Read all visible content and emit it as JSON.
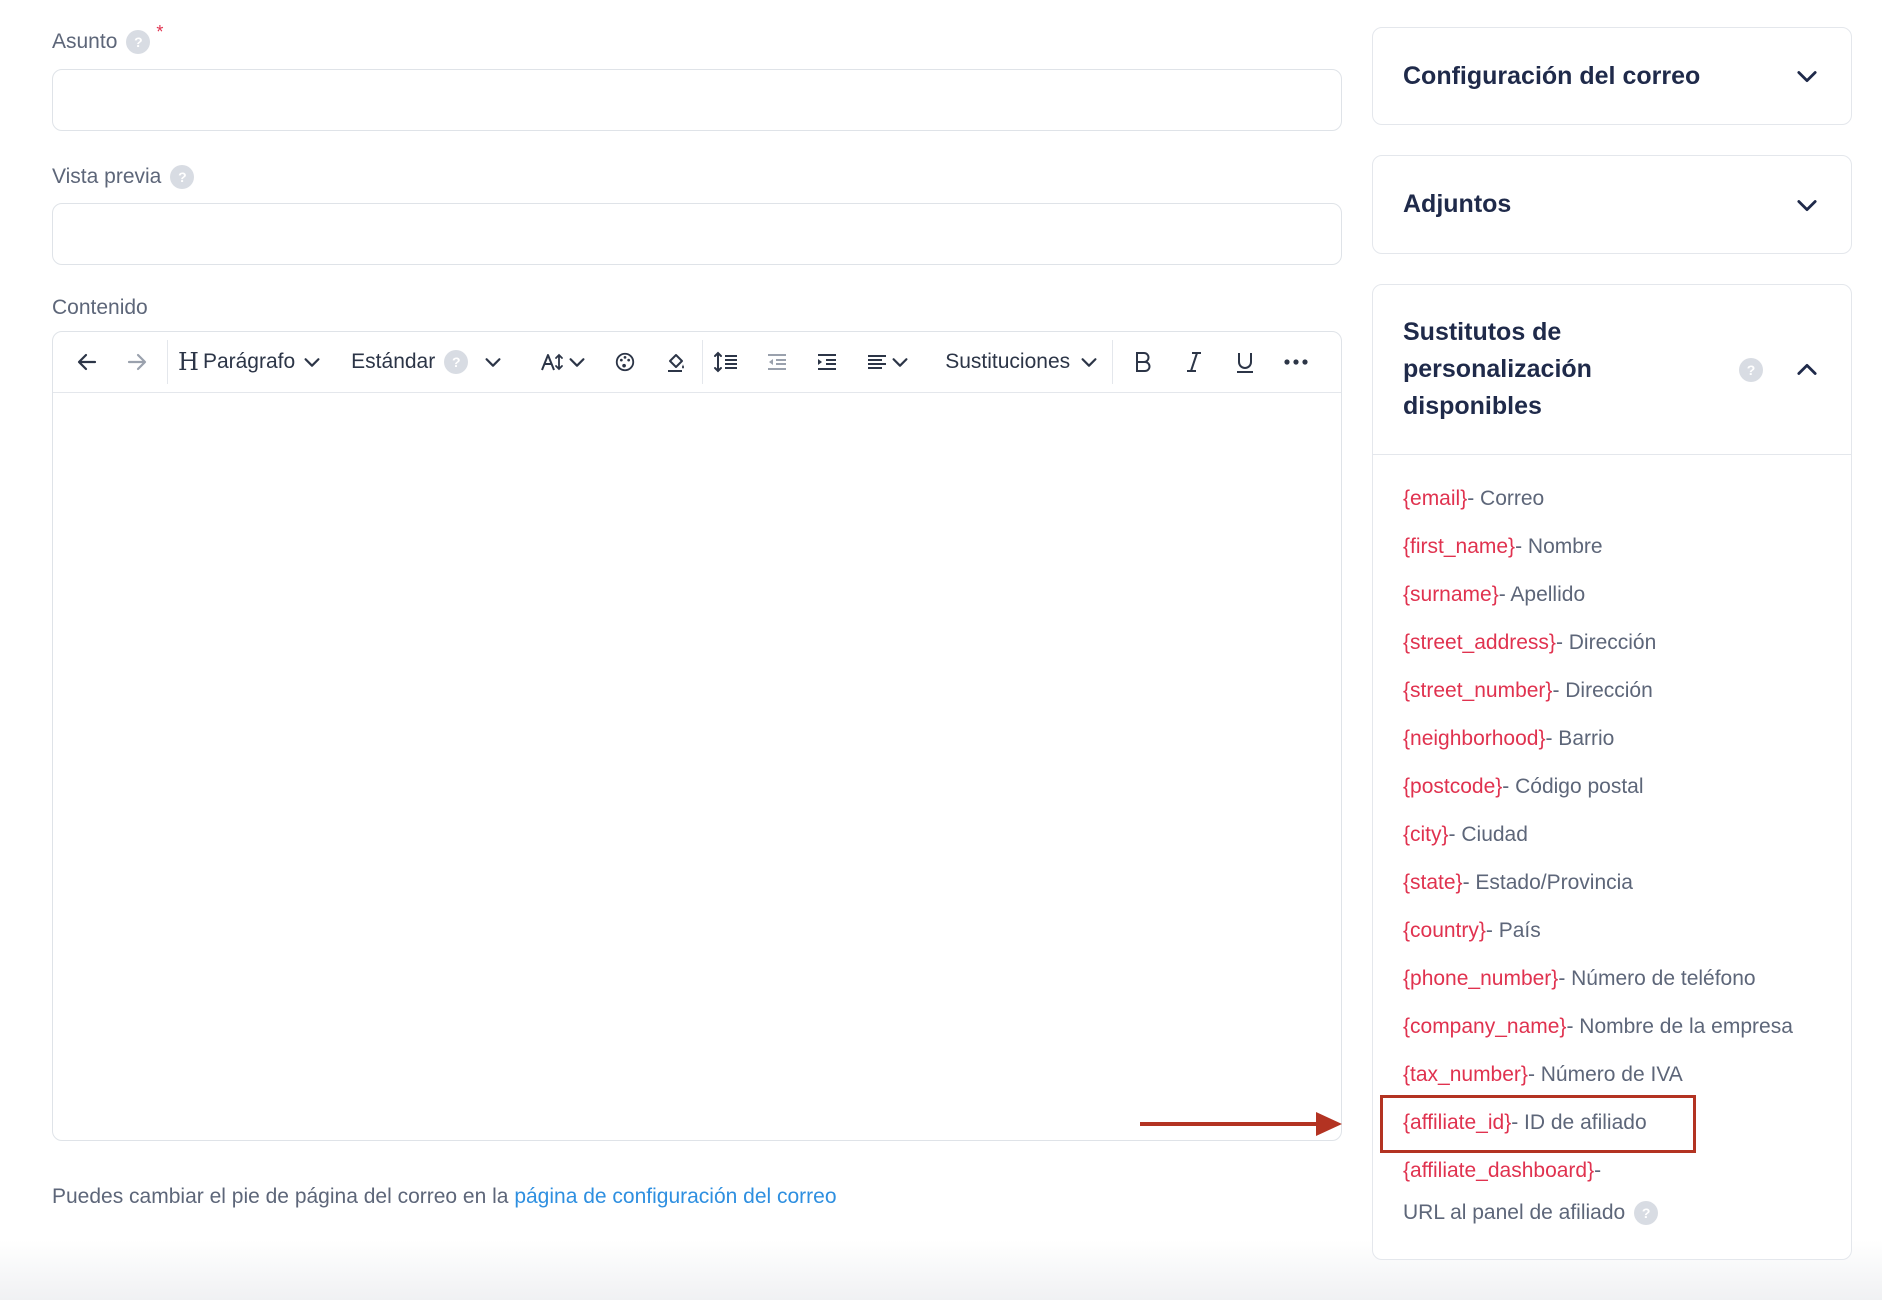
{
  "form": {
    "subject_label": "Asunto",
    "subject_required": "*",
    "subject_value": "",
    "preview_label": "Vista previa",
    "preview_value": "",
    "content_label": "Contenido"
  },
  "toolbar": {
    "paragraph_label": "Parágrafo",
    "standard_label": "Estándar",
    "substitutions_label": "Sustituciones"
  },
  "footer": {
    "text": "Puedes cambiar el pie de página del correo en la ",
    "link_text": "página de configuración del correo"
  },
  "sidebar": {
    "email_config_title": "Configuración del correo",
    "attachments_title": "Adjuntos",
    "substitutes_title_1": "Sustitutos de",
    "substitutes_title_2": "personalización",
    "substitutes_title_3": "disponibles",
    "substitutes": [
      {
        "token": "{email}",
        "desc": " - Correo"
      },
      {
        "token": "{first_name}",
        "desc": " - Nombre"
      },
      {
        "token": "{surname}",
        "desc": " - Apellido"
      },
      {
        "token": "{street_address}",
        "desc": " - Dirección"
      },
      {
        "token": "{street_number}",
        "desc": " - Dirección"
      },
      {
        "token": "{neighborhood}",
        "desc": " - Barrio"
      },
      {
        "token": "{postcode}",
        "desc": " - Código postal"
      },
      {
        "token": "{city}",
        "desc": " - Ciudad"
      },
      {
        "token": "{state}",
        "desc": " - Estado/Provincia"
      },
      {
        "token": "{country}",
        "desc": " - País"
      },
      {
        "token": "{phone_number}",
        "desc": " - Número de teléfono"
      },
      {
        "token": "{company_name}",
        "desc": " - Nombre de la empresa"
      },
      {
        "token": "{tax_number}",
        "desc": " - Número de IVA"
      },
      {
        "token": "{affiliate_id}",
        "desc": " - ID de afiliado"
      },
      {
        "token": "{affiliate_dashboard}",
        "desc": " -"
      }
    ],
    "last_line": "URL al panel de afiliado"
  },
  "help_glyph": "?",
  "colors": {
    "token": "#e0324f",
    "link": "#2e8fe0",
    "annotation": "#b33322",
    "title": "#1f2a4a"
  }
}
